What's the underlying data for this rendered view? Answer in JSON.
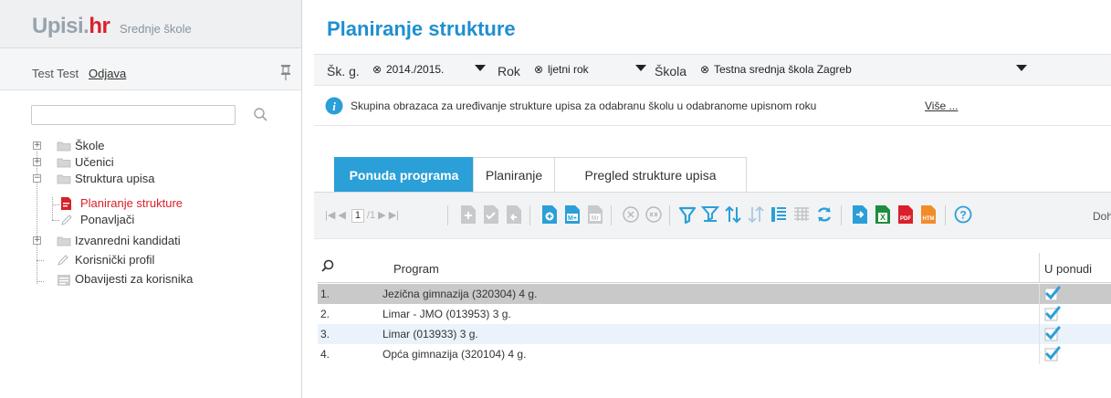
{
  "app": {
    "logo_main": "Upisi.",
    "logo_hr": "hr",
    "logo_sub": "Srednje škole"
  },
  "user": {
    "name": "Test Test",
    "logout": "Odjava"
  },
  "search": {
    "placeholder": ""
  },
  "tree": [
    {
      "label": "Škole"
    },
    {
      "label": "Učenici"
    },
    {
      "label": "Struktura upisa"
    },
    {
      "label": "Planiranje strukture"
    },
    {
      "label": "Ponavljači"
    },
    {
      "label": "Izvanredni kandidati"
    },
    {
      "label": "Korisnički profil"
    },
    {
      "label": "Obavijesti za korisnika"
    }
  ],
  "page": {
    "title": "Planiranje strukture"
  },
  "filters": {
    "sk_label": "Šk. g.",
    "sk_value": "2014./2015.",
    "rok_label": "Rok",
    "rok_value": "ljetni rok",
    "skola_label": "Škola",
    "skola_value": "Testna srednja škola Zagreb",
    "clear_symbol": "⊗"
  },
  "info": {
    "text": "Skupina obrazaca za uređivanje strukture upisa za odabranu školu u odabranome upisnom roku",
    "more": "Više ..."
  },
  "tabs": [
    "Ponuda programa",
    "Planiranje",
    "Pregled strukture upisa"
  ],
  "pager": {
    "first": "|◀",
    "prev": "◀",
    "page": "1",
    "total": "/1",
    "next": "▶",
    "last": "▶|"
  },
  "toolbar": {
    "fetch_label": "Dohva"
  },
  "grid": {
    "col_program": "Program",
    "col_ponudi": "U ponudi",
    "rows": [
      {
        "num": "1.",
        "program": "Jezična gimnazija (320304) 4 g.",
        "checked": true
      },
      {
        "num": "2.",
        "program": "Limar - JMO (013953) 3 g.",
        "checked": true
      },
      {
        "num": "3.",
        "program": "Limar (013933) 3 g.",
        "checked": true
      },
      {
        "num": "4.",
        "program": "Opća gimnazija (320104) 4 g.",
        "checked": true
      }
    ]
  },
  "colors": {
    "accent": "#2a9fd8",
    "title": "#1f8fd0",
    "brand_red": "#d9202a"
  }
}
